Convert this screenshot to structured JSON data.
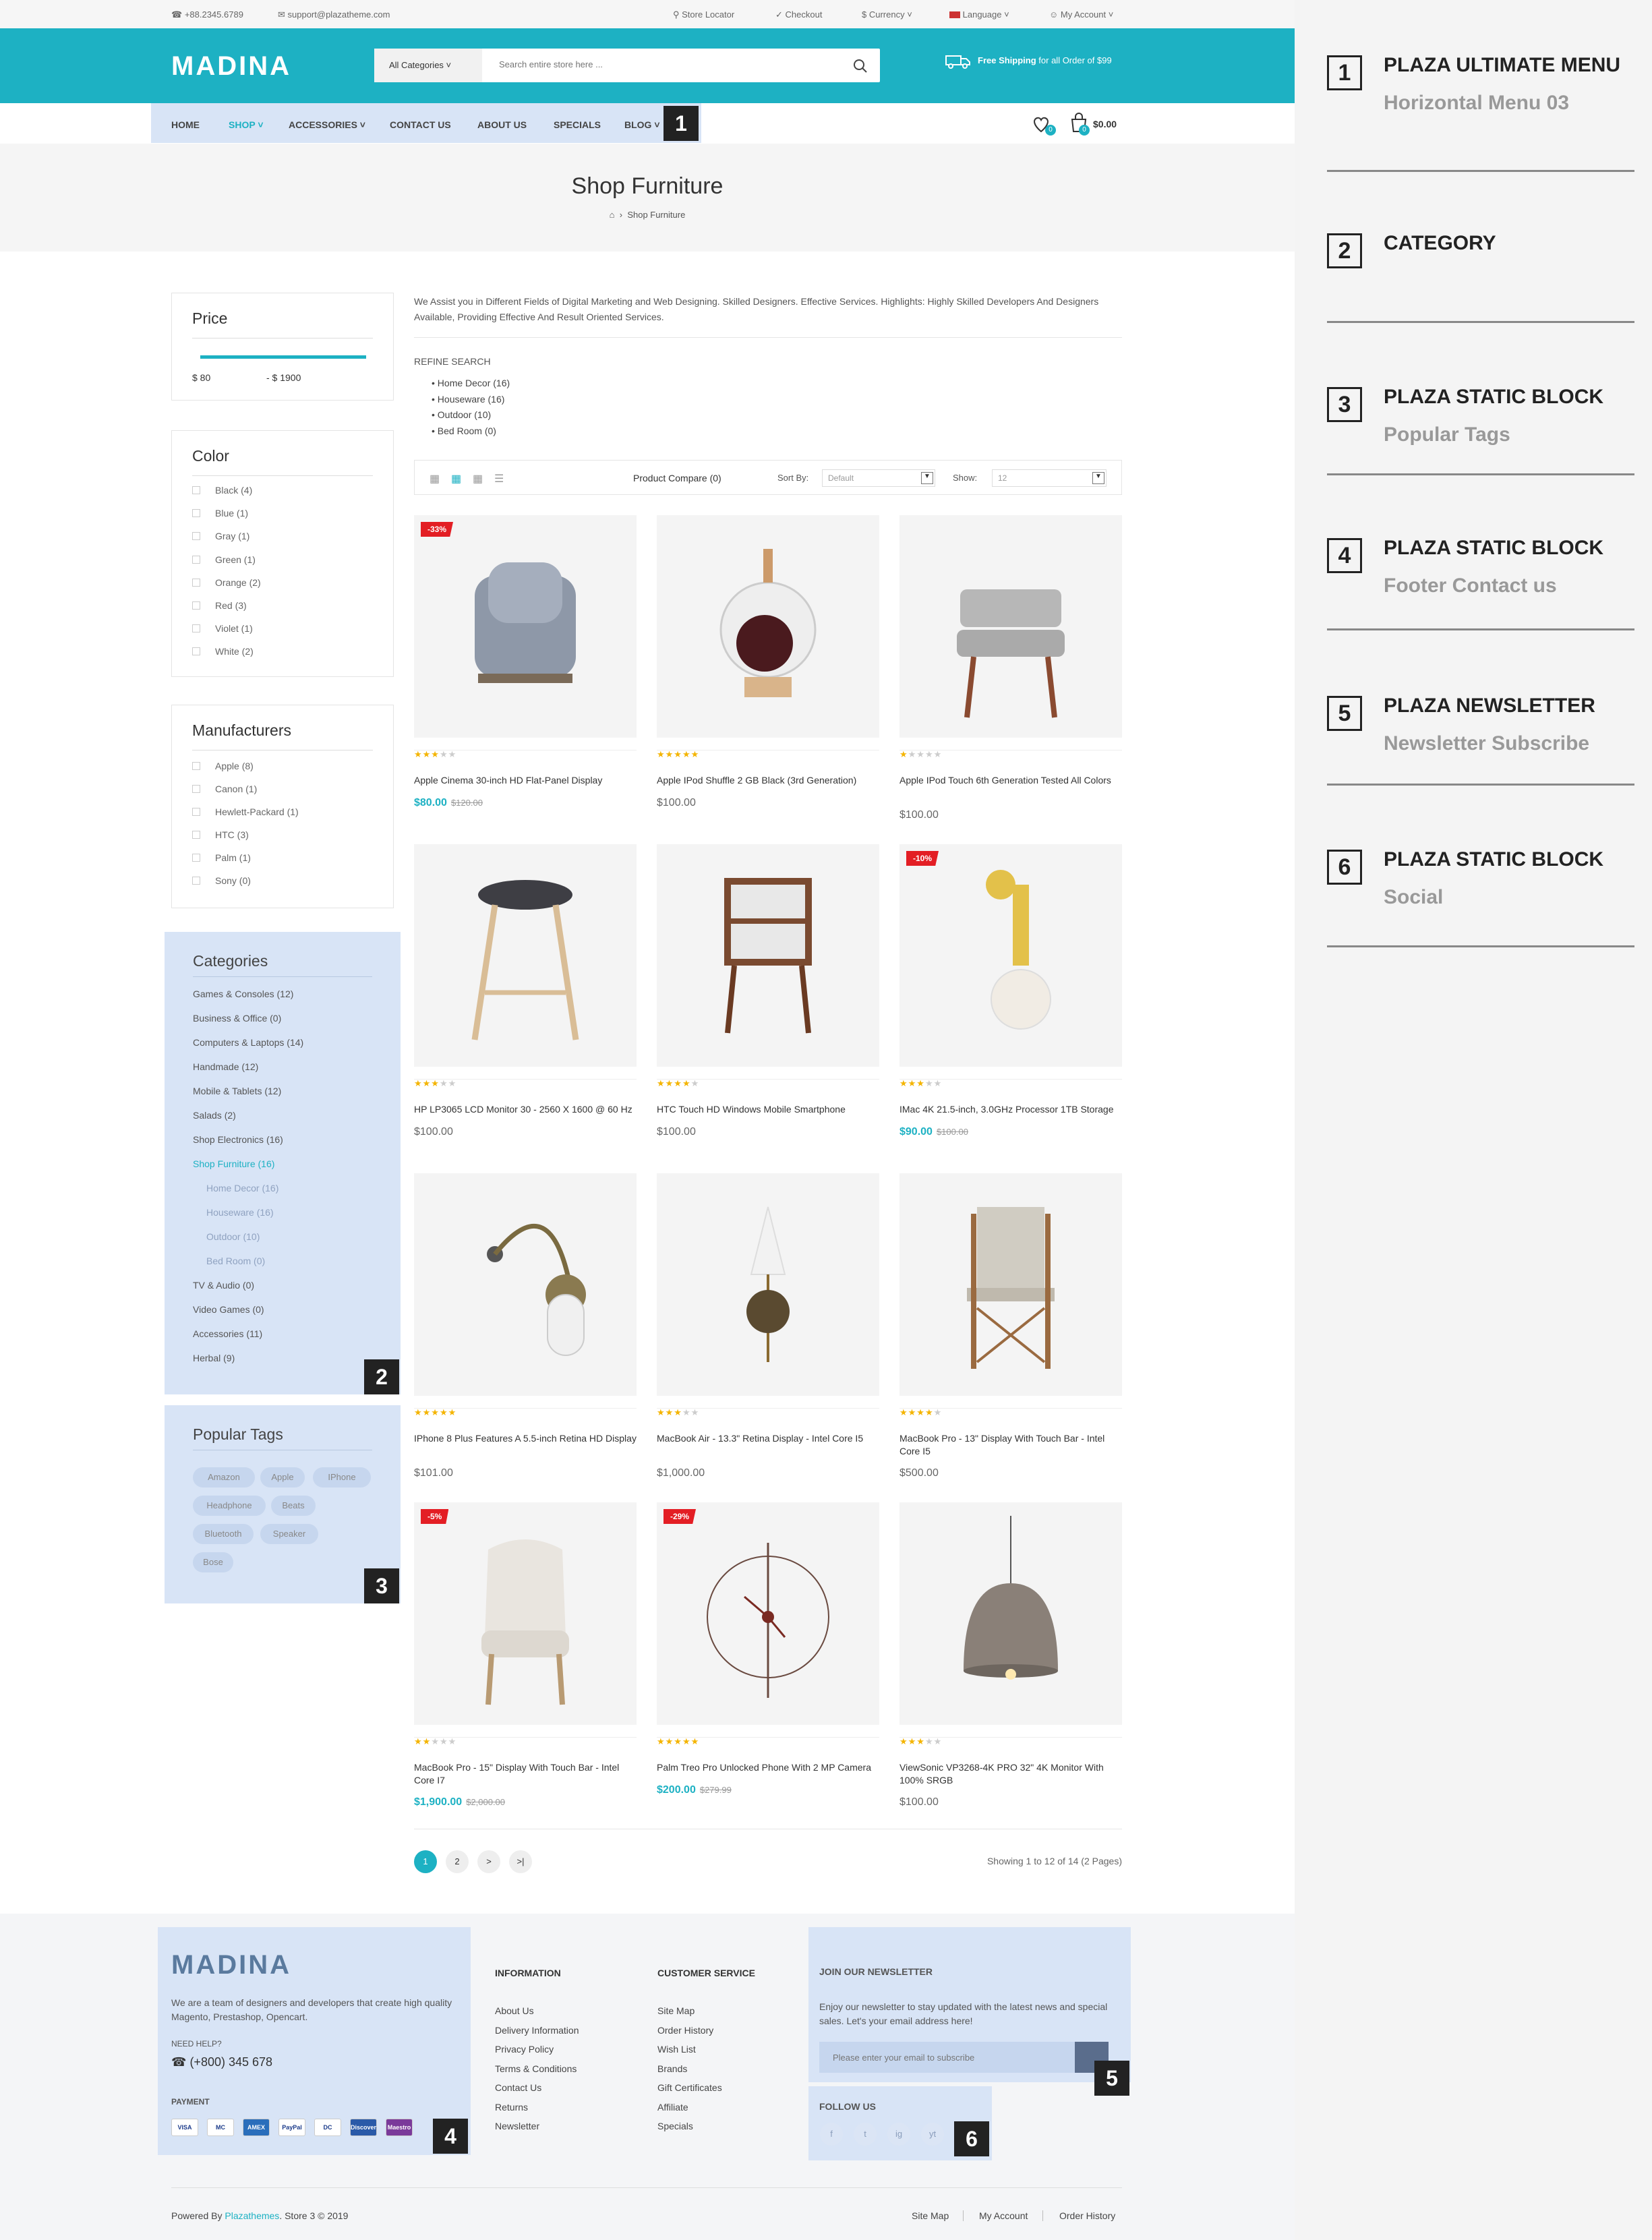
{
  "topbar": {
    "phone": "+88.2345.6789",
    "email": "support@plazatheme.com",
    "store_locator": "Store Locator",
    "checkout": "Checkout",
    "currency": "$ Currency",
    "language": "Language",
    "account": "My Account"
  },
  "header": {
    "logo": "MADINA",
    "category_select": "All Categories",
    "search_placeholder": "Search entire store here ...",
    "shipping_bold": "Free Shipping",
    "shipping_text": "for all Order of $99"
  },
  "nav": {
    "items": [
      "HOME",
      "SHOP",
      "ACCESSORIES",
      "CONTACT US",
      "ABOUT US",
      "SPECIALS",
      "BLOG"
    ],
    "wishlist_count": "0",
    "cart_count": "0",
    "cart_total": "$0.00"
  },
  "page": {
    "title": "Shop Furniture",
    "breadcrumb": "Shop Furniture"
  },
  "sidebar": {
    "price": {
      "title": "Price",
      "min": "$ 80",
      "max": "- $ 1900"
    },
    "color": {
      "title": "Color",
      "items": [
        "Black (4)",
        "Blue (1)",
        "Gray (1)",
        "Green (1)",
        "Orange (2)",
        "Red (3)",
        "Violet (1)",
        "White (2)"
      ]
    },
    "manufacturers": {
      "title": "Manufacturers",
      "items": [
        "Apple (8)",
        "Canon (1)",
        "Hewlett-Packard (1)",
        "HTC (3)",
        "Palm (1)",
        "Sony (0)"
      ]
    },
    "categories": {
      "title": "Categories",
      "items": [
        "Games & Consoles (12)",
        "Business & Office (0)",
        "Computers & Laptops (14)",
        "Handmade (12)",
        "Mobile & Tablets (12)",
        "Salads (2)",
        "Shop Electronics (16)",
        "Shop Furniture (16)",
        "Home Decor (16)",
        "Houseware (16)",
        "Outdoor (10)",
        "Bed Room (0)",
        "TV & Audio (0)",
        "Video Games (0)",
        "Accessories (11)",
        "Herbal (9)"
      ]
    },
    "tags": {
      "title": "Popular Tags",
      "items": [
        "Amazon",
        "Apple",
        "IPhone",
        "Headphone",
        "Beats",
        "Bluetooth",
        "Speaker",
        "Bose"
      ]
    }
  },
  "main": {
    "description": "We Assist you in Different Fields of Digital Marketing and Web Designing. Skilled Designers. Effective Services. Highlights: Highly Skilled Developers And Designers Available, Providing Effective And Result Oriented Services.",
    "refine_title": "REFINE SEARCH",
    "refine_items": [
      "Home Decor (16)",
      "Houseware (16)",
      "Outdoor (10)",
      "Bed Room (0)"
    ],
    "compare": "Product Compare (0)",
    "sort_label": "Sort By:",
    "sort_value": "Default",
    "show_label": "Show:",
    "show_value": "12",
    "products": [
      {
        "name": "Apple Cinema 30-inch HD Flat-Panel Display",
        "price": "$80.00",
        "old": "$120.00",
        "discount": "-33%",
        "rating": 3
      },
      {
        "name": "Apple IPod Shuffle 2 GB Black (3rd Generation)",
        "price": "$100.00",
        "old": "",
        "discount": "",
        "rating": 5
      },
      {
        "name": "Apple IPod Touch 6th Generation Tested All Colors",
        "price": "$100.00",
        "old": "",
        "discount": "",
        "rating": 1
      },
      {
        "name": "HP LP3065 LCD Monitor 30 - 2560 X 1600 @ 60 Hz",
        "price": "$100.00",
        "old": "",
        "discount": "",
        "rating": 3
      },
      {
        "name": "HTC Touch HD Windows Mobile Smartphone",
        "price": "$100.00",
        "old": "",
        "discount": "",
        "rating": 4
      },
      {
        "name": "IMac 4K 21.5-inch, 3.0GHz Processor 1TB Storage",
        "price": "$90.00",
        "old": "$100.00",
        "discount": "-10%",
        "rating": 3
      },
      {
        "name": "IPhone 8 Plus Features A 5.5-inch Retina HD Display",
        "price": "$101.00",
        "old": "",
        "discount": "",
        "rating": 5
      },
      {
        "name": "MacBook Air - 13.3\" Retina Display - Intel Core I5",
        "price": "$1,000.00",
        "old": "",
        "discount": "",
        "rating": 3
      },
      {
        "name": "MacBook Pro - 13\" Display With Touch Bar - Intel Core I5",
        "price": "$500.00",
        "old": "",
        "discount": "",
        "rating": 4
      },
      {
        "name": "MacBook Pro - 15\" Display With Touch Bar - Intel Core I7",
        "price": "$1,900.00",
        "old": "$2,000.00",
        "discount": "-5%",
        "rating": 2
      },
      {
        "name": "Palm Treo Pro Unlocked Phone With 2 MP Camera",
        "price": "$200.00",
        "old": "$279.99",
        "discount": "-29%",
        "rating": 5
      },
      {
        "name": "ViewSonic VP3268-4K PRO 32\" 4K Monitor With 100% SRGB",
        "price": "$100.00",
        "old": "",
        "discount": "",
        "rating": 3
      }
    ],
    "pagination": [
      "1",
      "2",
      ">",
      ">|"
    ],
    "showing": "Showing 1 to 12 of 14 (2 Pages)"
  },
  "footer": {
    "logo": "MADINA",
    "about": "We are a team of designers and developers that create high quality Magento, Prestashop, Opencart.",
    "need_help": "NEED HELP?",
    "phone": "(+800) 345 678",
    "payment": "PAYMENT",
    "payment_icons": [
      "VISA",
      "MC",
      "AMEX",
      "PayPal",
      "DC",
      "Discover",
      "Maestro"
    ],
    "info_title": "INFORMATION",
    "info_links": [
      "About Us",
      "Delivery Information",
      "Privacy Policy",
      "Terms & Conditions",
      "Contact Us",
      "Returns",
      "Newsletter"
    ],
    "cs_title": "CUSTOMER SERVICE",
    "cs_links": [
      "Site Map",
      "Order History",
      "Wish List",
      "Brands",
      "Gift Certificates",
      "Affiliate",
      "Specials"
    ],
    "newsletter_title": "JOIN OUR NEWSLETTER",
    "newsletter_text": "Enjoy our newsletter to stay updated with the latest news and special sales. Let's your email address here!",
    "newsletter_placeholder": "Please enter your email to subscribe",
    "follow": "FOLLOW US",
    "social": [
      "f",
      "t",
      "ig",
      "yt"
    ],
    "powered_pre": "Powered By",
    "powered_link": "Plazathemes",
    "powered_post": ". Store 3 © 2019",
    "bottom_links": [
      "Site Map",
      "My Account",
      "Order History"
    ]
  },
  "annotations": [
    {
      "num": "1",
      "title": "PLAZA ULTIMATE MENU",
      "sub": "Horizontal Menu 03"
    },
    {
      "num": "2",
      "title": "CATEGORY",
      "sub": ""
    },
    {
      "num": "3",
      "title": "PLAZA STATIC BLOCK",
      "sub": "Popular Tags"
    },
    {
      "num": "4",
      "title": "PLAZA STATIC BLOCK",
      "sub": "Footer Contact us"
    },
    {
      "num": "5",
      "title": "PLAZA NEWSLETTER",
      "sub": "Newsletter Subscribe"
    },
    {
      "num": "6",
      "title": "PLAZA STATIC BLOCK",
      "sub": "Social"
    }
  ],
  "colors": {
    "accent": "#1db1c3",
    "highlight": "#d8e4f6",
    "sale": "#e31e24",
    "star": "#f4b400"
  }
}
